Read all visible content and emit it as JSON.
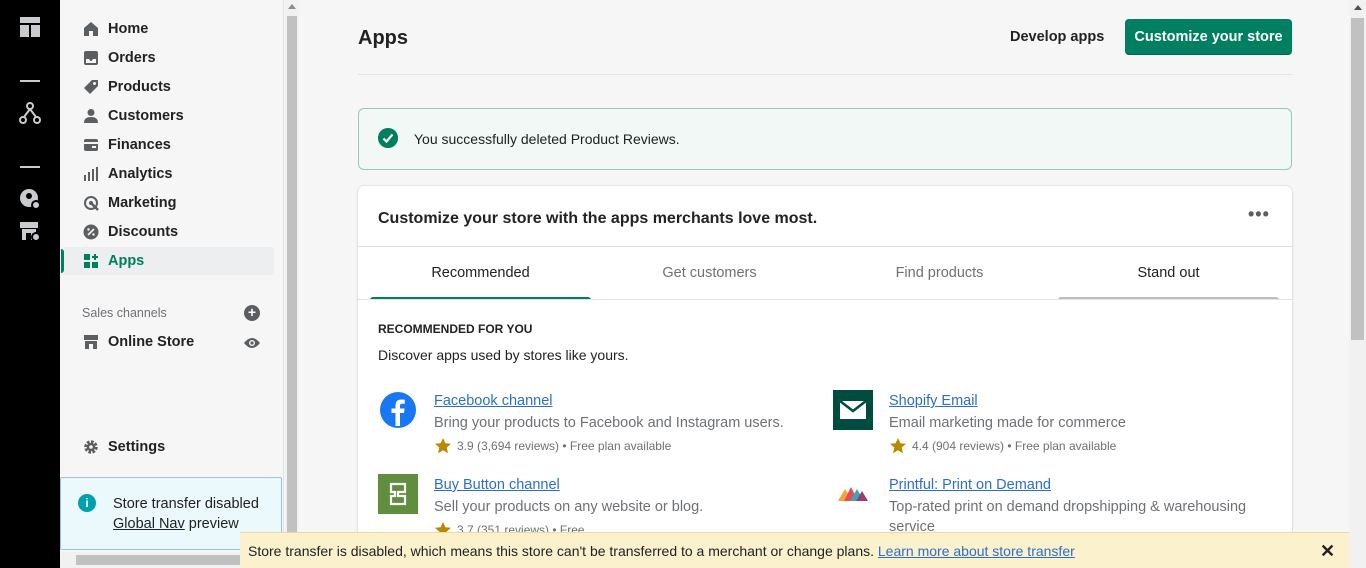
{
  "rail": {
    "icons": [
      "layout-icon",
      "branch-icon",
      "user-settings-icon",
      "store-settings-icon"
    ]
  },
  "sidebar": {
    "items": [
      {
        "label": "Home",
        "icon": "home-icon"
      },
      {
        "label": "Orders",
        "icon": "inbox-icon"
      },
      {
        "label": "Products",
        "icon": "tag-icon"
      },
      {
        "label": "Customers",
        "icon": "person-icon"
      },
      {
        "label": "Finances",
        "icon": "finance-icon"
      },
      {
        "label": "Analytics",
        "icon": "bar-chart-icon"
      },
      {
        "label": "Marketing",
        "icon": "target-icon"
      },
      {
        "label": "Discounts",
        "icon": "discount-icon"
      },
      {
        "label": "Apps",
        "icon": "apps-icon",
        "active": true
      }
    ],
    "sales_channels_label": "Sales channels",
    "online_store_label": "Online Store",
    "settings_label": "Settings",
    "transfer": {
      "line1": "Store transfer disabled",
      "link": "Global Nav",
      "line2_suffix": " preview"
    }
  },
  "header": {
    "title": "Apps",
    "develop_apps": "Develop apps",
    "customize_button": "Customize your store"
  },
  "banner": {
    "message": "You successfully deleted Product Reviews."
  },
  "card": {
    "title": "Customize your store with the apps merchants love most.",
    "more_icon": "•••",
    "tabs": [
      "Recommended",
      "Get customers",
      "Find products",
      "Stand out"
    ],
    "section_heading": "RECOMMENDED FOR YOU",
    "section_sub": "Discover apps used by stores like yours.",
    "apps": [
      {
        "name": "Facebook channel",
        "desc": "Bring your products to Facebook and Instagram users.",
        "rating": "3.9 (3,694 reviews) • Free plan available"
      },
      {
        "name": "Shopify Email",
        "desc": "Email marketing made for commerce",
        "rating": "4.4 (904 reviews) • Free plan available"
      },
      {
        "name": "Buy Button channel",
        "desc": "Sell your products on any website or blog.",
        "rating": "3.7 (351 reviews) • Free"
      },
      {
        "name": "Printful: Print on Demand",
        "desc": "Top-rated print on demand dropshipping & warehousing service",
        "rating": ""
      }
    ]
  },
  "bottom_bar": {
    "text": "Store transfer is disabled, which means this store can't be transferred to a merchant or change plans. ",
    "link": "Learn more about store transfer",
    "close": "✕"
  },
  "colors": {
    "accent": "#008060",
    "link": "#2c6ecb",
    "banner_bg": "#f1f8f5",
    "warning_bg": "#fcf1cd"
  }
}
